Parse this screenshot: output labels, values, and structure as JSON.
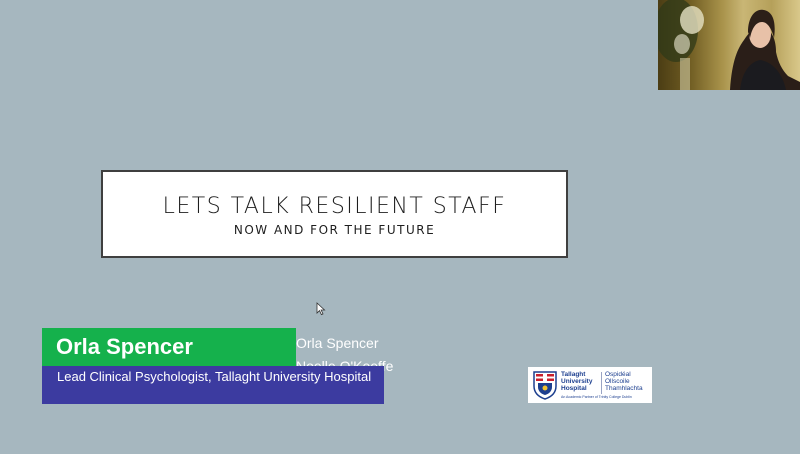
{
  "slide": {
    "title": "LETS TALK RESILIENT STAFF",
    "subtitle": "NOW AND FOR THE FUTURE",
    "presenters": [
      "Orla Spencer",
      "Noelle O'Keeffe"
    ]
  },
  "lower_third": {
    "name": "Orla Spencer",
    "role": "Lead Clinical Psychologist, Tallaght University Hospital",
    "name_bg": "#15b14c",
    "role_bg": "#3c3ba0"
  },
  "logo": {
    "english": "Tallaght\nUniversity\nHospital",
    "irish": "Ospidéal\nOllscoile\nThamhlachta",
    "partner": "An Academic Partner of Trinity College Dublin"
  },
  "icons": {
    "cursor": "mouse-pointer-icon",
    "crest": "hospital-crest-icon"
  },
  "colors": {
    "background": "#a6b7bf",
    "title_border": "#3f3f3f"
  }
}
